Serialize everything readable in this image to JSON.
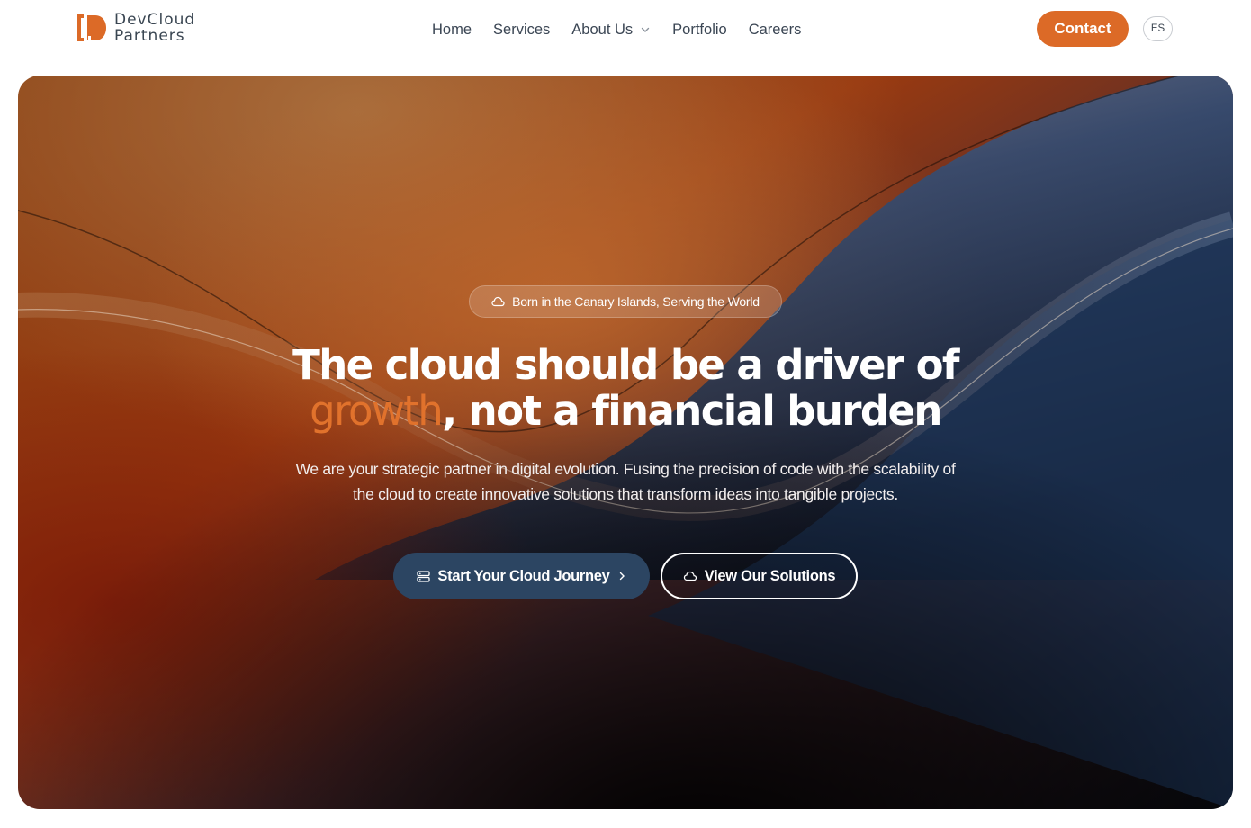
{
  "brand": {
    "line1": "DevCloud",
    "line2": "Partners",
    "accent_color": "#dc6a27"
  },
  "nav": {
    "items": [
      {
        "label": "Home"
      },
      {
        "label": "Services"
      },
      {
        "label": "About Us",
        "has_dropdown": true
      },
      {
        "label": "Portfolio"
      },
      {
        "label": "Careers"
      }
    ]
  },
  "header": {
    "contact_label": "Contact",
    "language_label": "ES"
  },
  "hero": {
    "badge_icon": "cloud-icon",
    "badge_text": "Born in the Canary Islands, Serving the World",
    "headline_line1": "The cloud should be a driver of",
    "headline_accent": "growth",
    "headline_rest": ", not a financial burden",
    "subtext": "We are your strategic partner in digital evolution. Fusing the precision of code with the scalability of the cloud to create innovative solutions that transform ideas into tangible projects.",
    "primary_button": {
      "label": "Start Your Cloud Journey",
      "icon": "server-icon",
      "trailing_icon": "chevron-right-icon"
    },
    "secondary_button": {
      "label": "View Our Solutions",
      "icon": "cloud-icon"
    }
  },
  "colors": {
    "primary_button_bg": "#2c4562",
    "headline_accent": "#e1722c"
  }
}
